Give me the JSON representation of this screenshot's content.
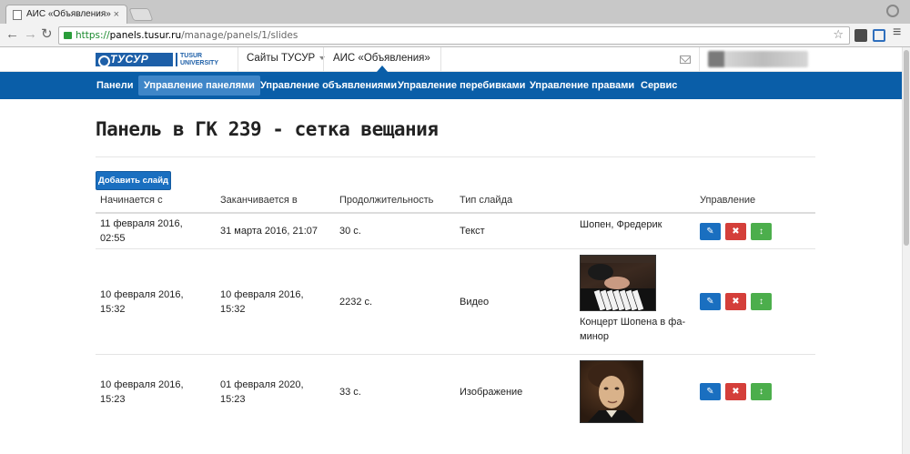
{
  "browser": {
    "tab_title": "АИС «Объявления»",
    "tab_close": "×",
    "url_protocol": "https://",
    "url_host": "panels.tusur.ru",
    "url_path": "/manage/panels/1/slides",
    "back": "←",
    "forward": "→",
    "reload": "↻",
    "star": "☆",
    "menu": "≡"
  },
  "header": {
    "logo_mark": "ТУСУР",
    "logo_sub_1": "TUSUR",
    "logo_sub_2": "UNIVERSITY",
    "sites_label": "Сайты ТУСУР",
    "app_label": "АИС «Объявления»"
  },
  "nav": {
    "items": [
      {
        "label": "Панели"
      },
      {
        "label": "Управление панелями"
      },
      {
        "label": "Управление объявлениями"
      },
      {
        "label": "Управление перебивками"
      },
      {
        "label": "Управление правами"
      },
      {
        "label": "Сервис"
      }
    ],
    "active_index": 1
  },
  "page": {
    "title": "Панель в ГК 239 - сетка вещания",
    "add_button": "Добавить слайд"
  },
  "table": {
    "headers": {
      "starts": "Начинается с",
      "ends": "Заканчивается в",
      "duration": "Продолжительность",
      "type": "Тип слайда",
      "actions": "Управление"
    },
    "rows": [
      {
        "starts_1": "11 февраля 2016,",
        "starts_2": "02:55",
        "ends_1": "31 марта 2016, 21:07",
        "ends_2": "",
        "duration": "30 с.",
        "type": "Текст",
        "content_1": "Шопен, Фредерик",
        "content_2": ""
      },
      {
        "starts_1": "10 февраля 2016,",
        "starts_2": "15:32",
        "ends_1": "10 февраля 2016,",
        "ends_2": "15:32",
        "duration": "2232 с.",
        "type": "Видео",
        "content_1": "Концерт Шопена в фа-",
        "content_2": "минор"
      },
      {
        "starts_1": "10 февраля 2016,",
        "starts_2": "15:23",
        "ends_1": "01 февраля 2020,",
        "ends_2": "15:23",
        "duration": "33 с.",
        "type": "Изображение",
        "content_1": "",
        "content_2": ""
      }
    ],
    "action_glyphs": {
      "edit": "✎",
      "delete": "✖",
      "move": "↕"
    }
  },
  "colors": {
    "navbar": "#0a5ea8",
    "nav_active": "#3f86c8",
    "primary": "#1a6fc0",
    "danger": "#d43f3a",
    "success": "#4cae4c"
  }
}
